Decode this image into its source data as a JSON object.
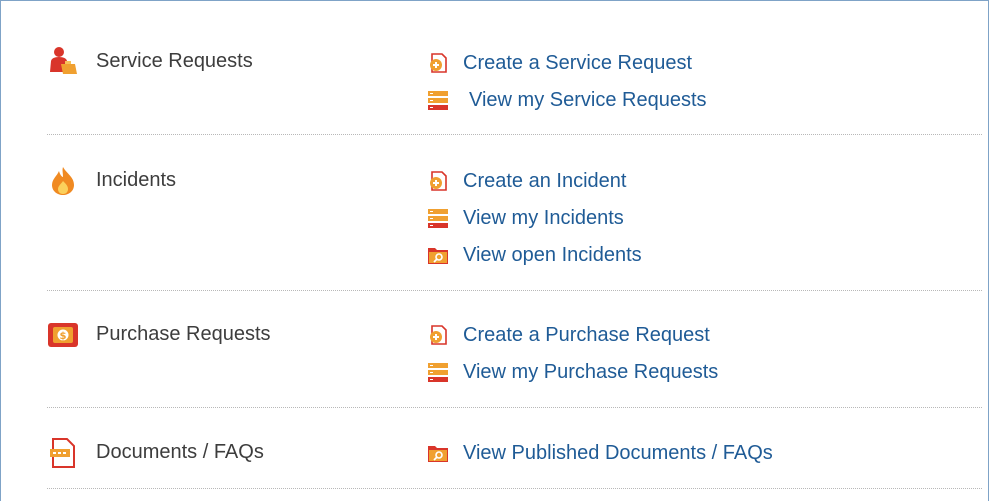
{
  "sections": [
    {
      "title": "Service Requests",
      "icon": "person-request-icon",
      "links": [
        {
          "label": "Create a Service Request",
          "icon": "create-document-icon"
        },
        {
          "label": "View my Service Requests",
          "icon": "list-stack-icon"
        }
      ]
    },
    {
      "title": "Incidents",
      "icon": "flame-icon",
      "links": [
        {
          "label": "Create an Incident",
          "icon": "create-document-icon"
        },
        {
          "label": "View my Incidents",
          "icon": "list-stack-icon"
        },
        {
          "label": "View open Incidents",
          "icon": "folder-search-icon"
        }
      ]
    },
    {
      "title": "Purchase Requests",
      "icon": "purchase-icon",
      "links": [
        {
          "label": "Create a Purchase Request",
          "icon": "create-document-icon"
        },
        {
          "label": "View my Purchase Requests",
          "icon": "list-stack-icon"
        }
      ]
    },
    {
      "title": "Documents / FAQs",
      "icon": "document-icon",
      "links": [
        {
          "label": "View Published Documents / FAQs",
          "icon": "folder-search-icon"
        }
      ]
    }
  ],
  "colors": {
    "link": "#1f5b96",
    "title": "#3d3d3d",
    "accent_orange": "#f0a030",
    "accent_red": "#d9352a",
    "border": "#7fa3c7",
    "divider": "#b8b8b8"
  }
}
